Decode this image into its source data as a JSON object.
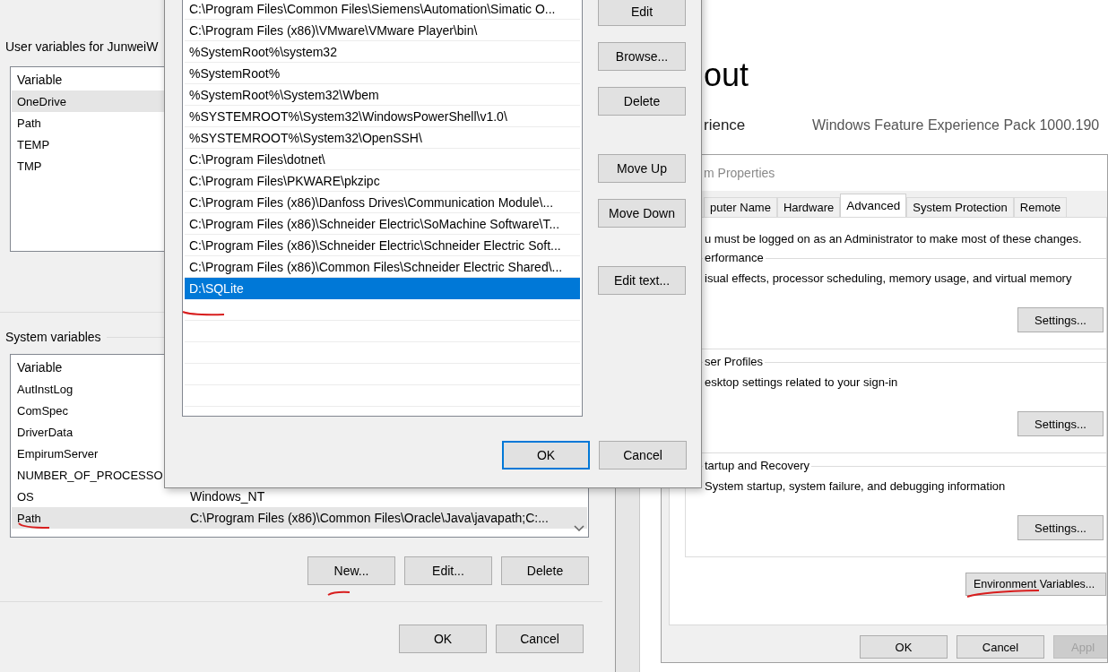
{
  "about_page": {
    "heading": "out",
    "rows": [
      {
        "label": "rience",
        "value": "Windows Feature Experience Pack 1000.190"
      }
    ]
  },
  "environment_variables": {
    "user_heading": "User variables for JunweiW",
    "user_column": "Variable",
    "user_rows": [
      {
        "name": "OneDrive",
        "selected": true
      },
      {
        "name": "Path",
        "selected": false
      },
      {
        "name": "TEMP",
        "selected": false
      },
      {
        "name": "TMP",
        "selected": false
      }
    ],
    "system_heading": "System variables",
    "system_column": "Variable",
    "system_rows": [
      {
        "name": "AutInstLog",
        "selected": false
      },
      {
        "name": "ComSpec",
        "selected": false
      },
      {
        "name": "DriverData",
        "selected": false
      },
      {
        "name": "EmpirumServer",
        "selected": false
      },
      {
        "name": "NUMBER_OF_PROCESSO",
        "selected": false
      },
      {
        "name": "OS",
        "value": "Windows_NT",
        "selected": false
      },
      {
        "name": "Path",
        "value": "C:\\Program Files (x86)\\Common Files\\Oracle\\Java\\javapath;C:...",
        "selected": true
      }
    ],
    "list_buttons": [
      "New...",
      "Edit...",
      "Delete"
    ],
    "buttons": [
      "OK",
      "Cancel"
    ]
  },
  "edit_dialog": {
    "entries": [
      {
        "text": "C:\\Program Files\\Common Files\\Siemens\\Automation\\Simatic O...",
        "selected": false
      },
      {
        "text": "C:\\Program Files (x86)\\VMware\\VMware Player\\bin\\",
        "selected": false
      },
      {
        "text": "%SystemRoot%\\system32",
        "selected": false
      },
      {
        "text": "%SystemRoot%",
        "selected": false
      },
      {
        "text": "%SystemRoot%\\System32\\Wbem",
        "selected": false
      },
      {
        "text": "%SYSTEMROOT%\\System32\\WindowsPowerShell\\v1.0\\",
        "selected": false
      },
      {
        "text": "%SYSTEMROOT%\\System32\\OpenSSH\\",
        "selected": false
      },
      {
        "text": "C:\\Program Files\\dotnet\\",
        "selected": false
      },
      {
        "text": "C:\\Program Files\\PKWARE\\pkzipc",
        "selected": false
      },
      {
        "text": "C:\\Program Files (x86)\\Danfoss Drives\\Communication Module\\...",
        "selected": false
      },
      {
        "text": "C:\\Program Files (x86)\\Schneider Electric\\SoMachine Software\\T...",
        "selected": false
      },
      {
        "text": "C:\\Program Files (x86)\\Schneider Electric\\Schneider Electric Soft...",
        "selected": false
      },
      {
        "text": "C:\\Program Files (x86)\\Common Files\\Schneider Electric Shared\\...",
        "selected": false
      },
      {
        "text": "D:\\SQLite",
        "selected": true
      }
    ],
    "side_button_groups": [
      [
        "Edit",
        "Browse...",
        "Delete"
      ],
      [
        "Move Up",
        "Move Down"
      ],
      [
        "Edit text..."
      ]
    ],
    "buttons": [
      {
        "label": "OK",
        "default": true
      },
      {
        "label": "Cancel",
        "default": false
      }
    ]
  },
  "system_properties": {
    "title": "m Properties",
    "tabs": [
      {
        "label": "puter Name",
        "selected": false
      },
      {
        "label": "Hardware",
        "selected": false
      },
      {
        "label": "Advanced",
        "selected": true
      },
      {
        "label": "System Protection",
        "selected": false
      },
      {
        "label": "Remote",
        "selected": false
      }
    ],
    "note": "u must be logged on as an Administrator to make most of these changes.",
    "groups": [
      {
        "title": "erformance",
        "description": "isual effects, processor scheduling, memory usage, and virtual memory",
        "button": "Settings..."
      },
      {
        "title": "ser Profiles",
        "description": "esktop settings related to your sign-in",
        "button": "Settings..."
      },
      {
        "title": "tartup and Recovery",
        "description": "System startup, system failure, and debugging information",
        "button": "Settings..."
      }
    ],
    "environment_button": "Environment Variables...",
    "buttons": [
      {
        "label": "OK",
        "disabled": false
      },
      {
        "label": "Cancel",
        "disabled": false
      },
      {
        "label": "Appl",
        "disabled": true
      }
    ]
  }
}
